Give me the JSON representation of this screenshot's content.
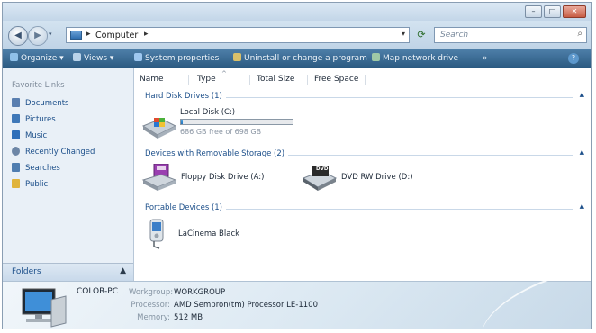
{
  "window": {
    "buttons": {
      "minimize": "–",
      "maximize": "□",
      "close": "✕"
    }
  },
  "address": {
    "location": "Computer",
    "separator": "▸",
    "dropdown": "▾",
    "search_placeholder": "Search"
  },
  "toolbar": {
    "items": [
      {
        "label": "Organize ▾",
        "icon": "organize-icon"
      },
      {
        "label": "Views ▾",
        "icon": "views-icon"
      },
      {
        "label": "System properties",
        "icon": "system-properties-icon"
      },
      {
        "label": "Uninstall or change a program",
        "icon": "uninstall-icon"
      },
      {
        "label": "Map network drive",
        "icon": "map-drive-icon"
      },
      {
        "label": "»",
        "icon": ""
      }
    ],
    "help": "?"
  },
  "sidebar": {
    "title": "Favorite Links",
    "items": [
      {
        "label": "Documents",
        "icon": "documents-icon",
        "color": "#5a7fb0"
      },
      {
        "label": "Pictures",
        "icon": "pictures-icon",
        "color": "#3f78b8"
      },
      {
        "label": "Music",
        "icon": "music-icon",
        "color": "#2f6fb9"
      },
      {
        "label": "Recently Changed",
        "icon": "recent-icon",
        "color": "#6d86a6"
      },
      {
        "label": "Searches",
        "icon": "searches-icon",
        "color": "#4f7db0"
      },
      {
        "label": "Public",
        "icon": "public-icon",
        "color": "#e0b43c"
      }
    ],
    "folders_label": "Folders",
    "folders_chevron": "▲"
  },
  "columns": [
    "Name",
    "Type",
    "Total Size",
    "Free Space"
  ],
  "groups": [
    {
      "title": "Hard Disk Drives (1)"
    },
    {
      "title": "Devices with Removable Storage (2)"
    },
    {
      "title": "Portable Devices (1)"
    }
  ],
  "items": {
    "local_disk": {
      "name": "Local Disk (C:)",
      "free_text": "686 GB free of 698 GB",
      "used_fraction": 0.017
    },
    "floppy": {
      "name": "Floppy Disk Drive (A:)"
    },
    "dvd": {
      "name": "DVD RW Drive (D:)",
      "badge": "DVD"
    },
    "portable": {
      "name": "LaCinema Black"
    }
  },
  "details": {
    "computer_name": "COLOR-PC",
    "workgroup_label": "Workgroup:",
    "workgroup": "WORKGROUP",
    "processor_label": "Processor:",
    "processor": "AMD Sempron(tm) Processor LE-1100",
    "memory_label": "Memory:",
    "memory": "512 MB"
  }
}
